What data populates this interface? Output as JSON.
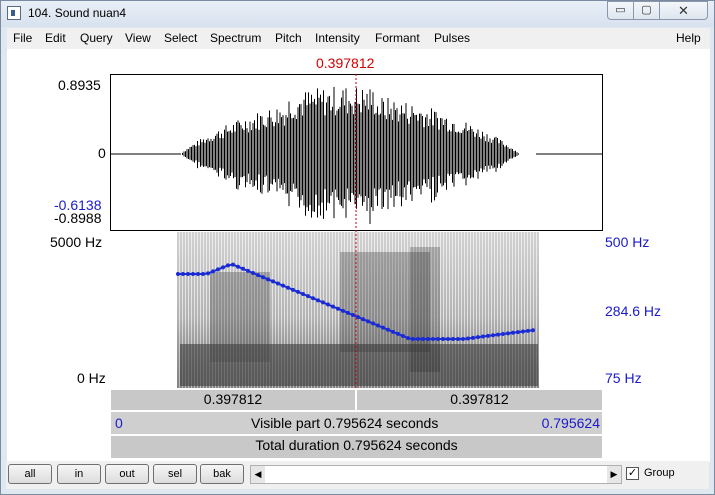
{
  "window": {
    "title": "104. Sound nuan4",
    "min_glyph": "▭",
    "max_glyph": "▢",
    "close_glyph": "✕"
  },
  "menu": {
    "items": [
      "File",
      "Edit",
      "Query",
      "View",
      "Select",
      "Spectrum",
      "Pitch",
      "Intensity",
      "Formant",
      "Pulses"
    ],
    "help": "Help"
  },
  "cursor": {
    "time_label": "0.397812",
    "time_fraction": 0.5
  },
  "waveform": {
    "y_max": "0.8935",
    "y_zero": "0",
    "y_min": "-0.8988",
    "y_cursor_value": "-0.6138"
  },
  "spectrogram": {
    "freq_top": "5000 Hz",
    "freq_bottom": "0 Hz",
    "pitch_top": "500 Hz",
    "pitch_mid": "284.6 Hz",
    "pitch_bottom": "75 Hz"
  },
  "time_bars": {
    "left_segment": "0.397812",
    "right_segment": "0.397812",
    "visible_start": "0",
    "visible_text": "Visible part 0.795624 seconds",
    "visible_end": "0.795624",
    "total_text": "Total duration 0.795624 seconds"
  },
  "bottom": {
    "buttons": [
      "all",
      "in",
      "out",
      "sel",
      "bak"
    ],
    "scroll_left": "◀",
    "scroll_right": "▶",
    "group_checked": "✓",
    "group_label": "Group"
  },
  "colors": {
    "pitch_line": "#1a2bd6",
    "cursor": "#cc0000",
    "axis_blue": "#1a1acc"
  }
}
